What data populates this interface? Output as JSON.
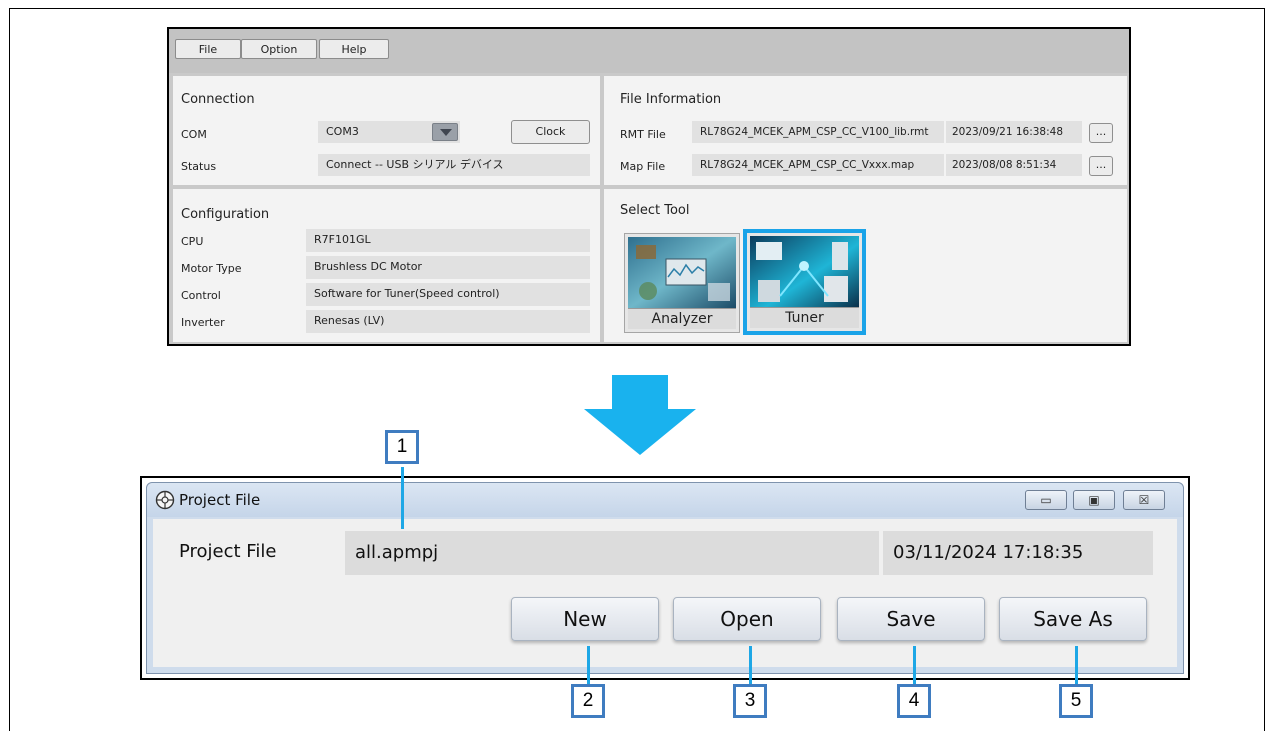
{
  "tool_window": {
    "menu": [
      "File",
      "Option",
      "Help"
    ],
    "connection": {
      "title": "Connection",
      "com_label": "COM",
      "com_value": "COM3",
      "clock_button": "Clock",
      "status_label": "Status",
      "status_value": "Connect -- USB シリアル デバイス"
    },
    "file_information": {
      "title": "File Information",
      "rmt_label": "RMT File",
      "rmt_name": "RL78G24_MCEK_APM_CSP_CC_V100_lib.rmt",
      "rmt_date": "2023/09/21 16:38:48",
      "map_label": "Map File",
      "map_name": "RL78G24_MCEK_APM_CSP_CC_Vxxx.map",
      "map_date": "2023/08/08 8:51:34",
      "browse_label": "..."
    },
    "configuration": {
      "title": "Configuration",
      "rows": [
        {
          "label": "CPU",
          "value": "R7F101GL"
        },
        {
          "label": "Motor Type",
          "value": "Brushless DC Motor"
        },
        {
          "label": "Control",
          "value": "Software for Tuner(Speed control)"
        },
        {
          "label": "Inverter",
          "value": "Renesas (LV)"
        }
      ]
    },
    "select_tool": {
      "title": "Select Tool",
      "tools": [
        {
          "label": "Analyzer",
          "selected": false
        },
        {
          "label": "Tuner",
          "selected": true
        }
      ],
      "selected_color": "#1aa3e8"
    }
  },
  "project_file_window": {
    "title": "Project File",
    "field_label": "Project File",
    "file_name": "all.apmpj",
    "timestamp": "03/11/2024 17:18:35",
    "buttons": {
      "new": "New",
      "open": "Open",
      "save": "Save",
      "save_as": "Save As"
    },
    "window_controls": [
      "minimize",
      "maximize",
      "close"
    ]
  },
  "callouts": [
    "1",
    "2",
    "3",
    "4",
    "5"
  ],
  "colors": {
    "arrow": "#19b2ee",
    "callout_border": "#3f7cc0",
    "callout_line": "#1ea7e6"
  }
}
